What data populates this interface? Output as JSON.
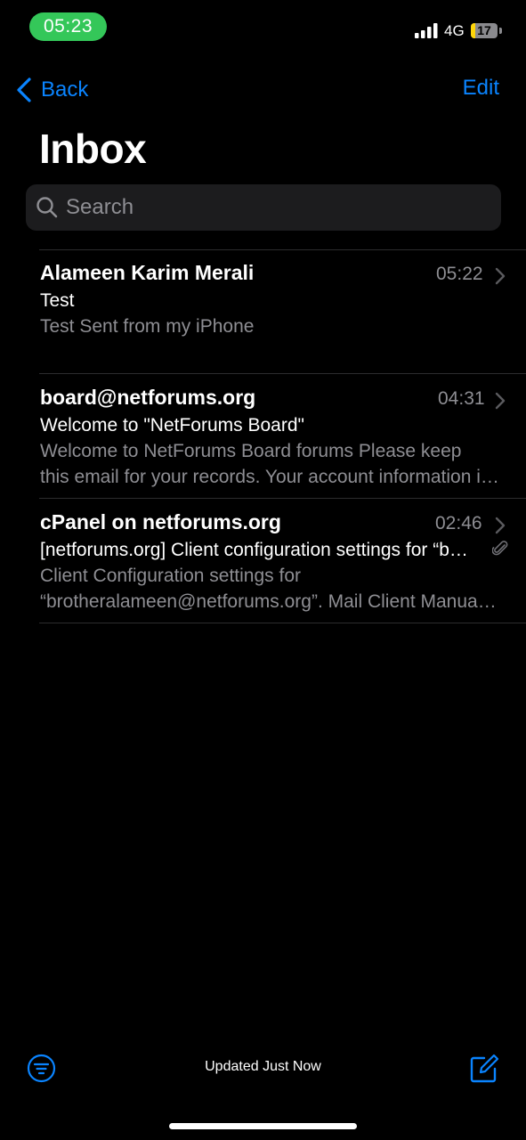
{
  "status_bar": {
    "time": "05:23",
    "network": "4G",
    "battery_level": "17",
    "battery_fraction": 0.17,
    "pill_color": "#34c759",
    "battery_color": "#ffd60a"
  },
  "nav": {
    "back_label": "Back",
    "edit_label": "Edit",
    "title": "Inbox",
    "accent": "#0a84ff"
  },
  "search": {
    "placeholder": "Search"
  },
  "messages": [
    {
      "sender": "Alameen Karim Merali",
      "time": "05:22",
      "subject": "Test",
      "preview_lines": [
        "Test Sent from my iPhone"
      ],
      "attachment": false
    },
    {
      "sender": "board@netforums.org",
      "time": "04:31",
      "subject": "Welcome to \"NetForums Board\"",
      "preview_lines": [
        "Welcome to NetForums Board forums Please keep",
        "this email for your records. Your account information is as follows"
      ],
      "attachment": false
    },
    {
      "sender": "cPanel on netforums.org",
      "time": "02:46",
      "subject": "[netforums.org] Client configuration settings for “brotheralameen@netforums.org”",
      "preview_lines": [
        "Client Configuration settings for",
        "“brotheralameen@netforums.org”. Mail Client Manual Settings"
      ],
      "attachment": true
    }
  ],
  "toolbar": {
    "status": "Updated Just Now",
    "filter_icon": "filter-icon",
    "compose_icon": "compose-icon"
  }
}
